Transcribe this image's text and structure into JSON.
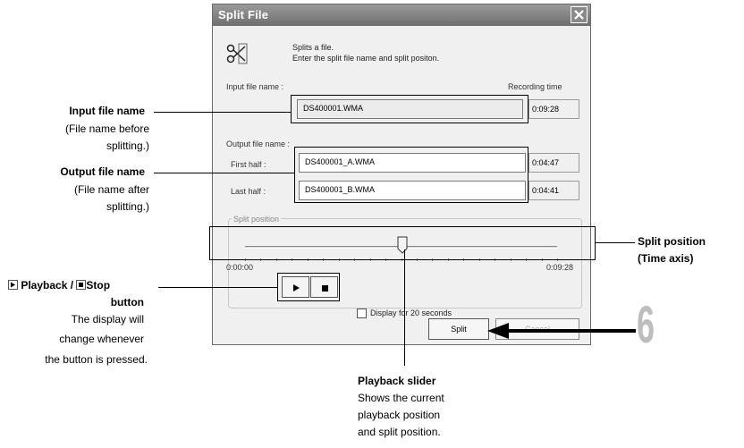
{
  "dialog": {
    "title": "Split File",
    "description_line1": "Splits a file.",
    "description_line2": "Enter the split file name and split positon.",
    "input_label": "Input file name :",
    "recording_time_label": "Recording time",
    "input_value": "DS400001.WMA",
    "input_time": "0:09:28",
    "output_label": "Output file name :",
    "first_half_label": "First half :",
    "first_half_value": "DS400001_A.WMA",
    "first_half_time": "0:04:47",
    "last_half_label": "Last half :",
    "last_half_value": "DS400001_B.WMA",
    "last_half_time": "0:04:41",
    "split_position_label": "Split position",
    "time_start": "0:00:00",
    "time_end": "0:09:28",
    "slider_position_fraction": 0.5,
    "display_20s_label": "Display for 20 seconds",
    "display_20s_checked": false,
    "split_button": "Split",
    "cancel_button": "Cancel"
  },
  "callouts": {
    "input_title": "Input file name",
    "input_desc1": "(File name before",
    "input_desc2": "splitting.)",
    "output_title": "Output file name",
    "output_desc1": "(File name after",
    "output_desc2": "splitting.)",
    "playback_title_a": "Playback /",
    "playback_title_b": "Stop",
    "playback_title_c": "button",
    "playback_desc1": "The display will",
    "playback_desc2": "change whenever",
    "playback_desc3": "the button is pressed.",
    "split_pos_title1": "Split position",
    "split_pos_title2": "(Time axis)",
    "slider_title": "Playback slider",
    "slider_desc1": "Shows the current",
    "slider_desc2": "playback position",
    "slider_desc3": "and split position.",
    "step_number": "6"
  }
}
